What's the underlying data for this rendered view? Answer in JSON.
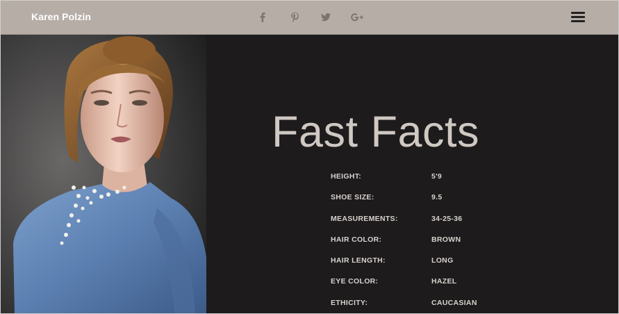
{
  "header": {
    "brand": "Karen Polzin",
    "social_icons": [
      "facebook-icon",
      "pinterest-icon",
      "twitter-icon",
      "google-plus-icon"
    ]
  },
  "main": {
    "title": "Fast Facts",
    "facts": [
      {
        "label": "HEIGHT:",
        "value": "5'9"
      },
      {
        "label": "SHOE SIZE:",
        "value": "9.5"
      },
      {
        "label": "MEASUREMENTS:",
        "value": "34-25-36"
      },
      {
        "label": "HAIR COLOR:",
        "value": "BROWN"
      },
      {
        "label": "HAIR LENGTH:",
        "value": "LONG"
      },
      {
        "label": "EYE COLOR:",
        "value": "HAZEL"
      },
      {
        "label": "ETHICITY:",
        "value": "CAUCASIAN"
      }
    ]
  },
  "colors": {
    "header_bg": "#b6ada7",
    "content_bg": "#1d1b1c",
    "title_text": "#cfc8c3",
    "fact_text": "#d8d2ce",
    "dress": "#5b7fb0"
  }
}
